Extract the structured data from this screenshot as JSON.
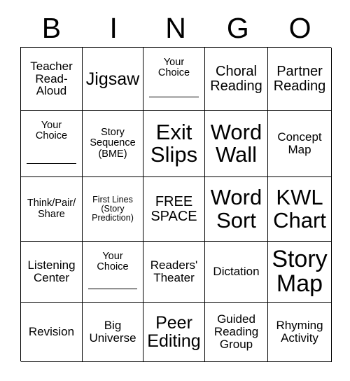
{
  "card": {
    "title_letters": [
      "B",
      "I",
      "N",
      "G",
      "O"
    ],
    "columns": 5,
    "rows": 5,
    "free_space_label": "FREE\nSPACE",
    "write_in_label": "Your\nChoice",
    "cells": [
      {
        "text": "Teacher\nRead-\nAloud",
        "size": "md",
        "write_in": false
      },
      {
        "text": "Jigsaw",
        "size": "xl",
        "write_in": false
      },
      {
        "text": "Your\nChoice",
        "size": "sm",
        "write_in": true
      },
      {
        "text": "Choral\nReading",
        "size": "lg",
        "write_in": false
      },
      {
        "text": "Partner\nReading",
        "size": "lg",
        "write_in": false
      },
      {
        "text": "Your\nChoice",
        "size": "sm",
        "write_in": true
      },
      {
        "text": "Story\nSequence\n(BME)",
        "size": "sm",
        "write_in": false
      },
      {
        "text": "Exit\nSlips",
        "size": "xxl",
        "write_in": false
      },
      {
        "text": "Word\nWall",
        "size": "xxl",
        "write_in": false
      },
      {
        "text": "Concept\nMap",
        "size": "md",
        "write_in": false
      },
      {
        "text": "Think/Pair/\nShare",
        "size": "sm",
        "write_in": false
      },
      {
        "text": "First Lines\n(Story\nPrediction)",
        "size": "xs",
        "write_in": false
      },
      {
        "text": "FREE\nSPACE",
        "size": "lg",
        "write_in": false
      },
      {
        "text": "Word\nSort",
        "size": "xxl",
        "write_in": false
      },
      {
        "text": "KWL\nChart",
        "size": "xxl",
        "write_in": false
      },
      {
        "text": "Listening\nCenter",
        "size": "md",
        "write_in": false
      },
      {
        "text": "Your\nChoice",
        "size": "sm",
        "write_in": true
      },
      {
        "text": "Readers'\nTheater",
        "size": "md",
        "write_in": false
      },
      {
        "text": "Dictation",
        "size": "md",
        "write_in": false
      },
      {
        "text": "Story\nMap",
        "size": "huge",
        "write_in": false
      },
      {
        "text": "Revision",
        "size": "md",
        "write_in": false
      },
      {
        "text": "Big\nUniverse",
        "size": "md",
        "write_in": false
      },
      {
        "text": "Peer\nEditing",
        "size": "xl",
        "write_in": false
      },
      {
        "text": "Guided\nReading\nGroup",
        "size": "md",
        "write_in": false
      },
      {
        "text": "Rhyming\nActivity",
        "size": "md",
        "write_in": false
      }
    ]
  },
  "colors": {
    "background": "#ffffff",
    "text": "#000000",
    "grid_line": "#000000"
  }
}
